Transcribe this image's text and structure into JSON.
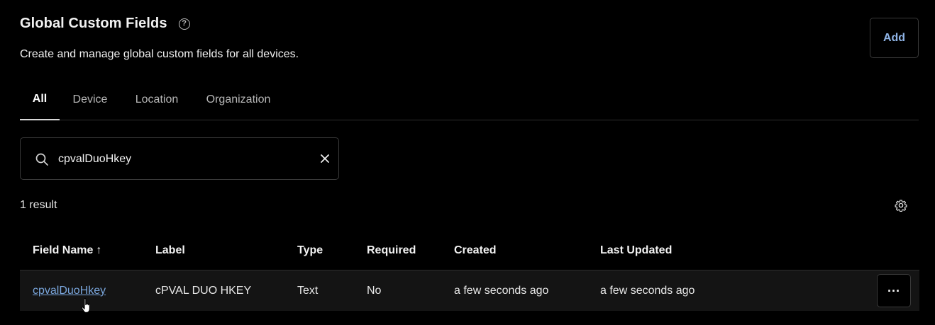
{
  "header": {
    "title": "Global Custom Fields",
    "help_icon": "question-circle-icon",
    "subtitle": "Create and manage global custom fields for all devices.",
    "add_label": "Add",
    "accent_color": "#8fb4e6"
  },
  "tabs": [
    {
      "label": "All",
      "active": true
    },
    {
      "label": "Device",
      "active": false
    },
    {
      "label": "Location",
      "active": false
    },
    {
      "label": "Organization",
      "active": false
    }
  ],
  "search": {
    "value": "cpvalDuoHkey",
    "placeholder": "",
    "icon": "search-icon",
    "clear_icon": "close-icon"
  },
  "results": {
    "count_text": "1 result",
    "settings_icon": "gear-icon"
  },
  "table": {
    "columns": [
      "Field Name",
      "Label",
      "Type",
      "Required",
      "Created",
      "Last Updated"
    ],
    "sort_indicator": "↑",
    "rows": [
      {
        "field_name": "cpvalDuoHkey",
        "label": "cPVAL DUO HKEY",
        "type": "Text",
        "required": "No",
        "created": "a few seconds ago",
        "last_updated": "a few seconds ago",
        "menu_label": "···"
      }
    ]
  }
}
